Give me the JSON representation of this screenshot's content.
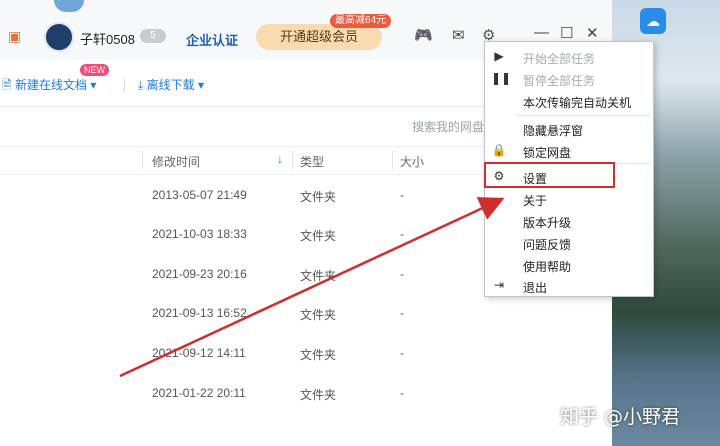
{
  "titlebar": {
    "username": "子轩0508",
    "level": "5",
    "cert_label": "企业认证",
    "vip_button": "开通超级会员",
    "vip_tag": "最高减64元"
  },
  "toolbar": {
    "new_doc": "新建在线文档",
    "new_tag": "NEW",
    "offline": "离线下载"
  },
  "search": {
    "placeholder": "搜索我的网盘"
  },
  "table": {
    "headers": {
      "modified": "修改时间",
      "type": "类型",
      "size": "大小"
    },
    "rows": [
      {
        "date": "2013-05-07 21:49",
        "type": "文件夹",
        "size": "-"
      },
      {
        "date": "2021-10-03 18:33",
        "type": "文件夹",
        "size": "-"
      },
      {
        "date": "2021-09-23 20:16",
        "type": "文件夹",
        "size": "-"
      },
      {
        "date": "2021-09-13 16:52",
        "type": "文件夹",
        "size": "-"
      },
      {
        "date": "2021-09-12 14:11",
        "type": "文件夹",
        "size": "-"
      },
      {
        "date": "2021-01-22 20:11",
        "type": "文件夹",
        "size": "-"
      }
    ]
  },
  "menu": {
    "items": [
      {
        "label": "开始全部任务",
        "icon": "play-icon",
        "disabled": true
      },
      {
        "label": "暂停全部任务",
        "icon": "pause-icon",
        "disabled": true
      },
      {
        "label": "本次传输完自动关机",
        "icon": "",
        "disabled": false
      },
      {
        "label": "隐藏悬浮窗",
        "icon": "",
        "disabled": false
      },
      {
        "label": "锁定网盘",
        "icon": "lock-icon",
        "disabled": false
      },
      {
        "label": "设置",
        "icon": "gear-icon",
        "disabled": false
      },
      {
        "label": "关于",
        "icon": "",
        "disabled": false
      },
      {
        "label": "版本升级",
        "icon": "",
        "disabled": false
      },
      {
        "label": "问题反馈",
        "icon": "",
        "disabled": false
      },
      {
        "label": "使用帮助",
        "icon": "",
        "disabled": false
      },
      {
        "label": "退出",
        "icon": "exit-icon",
        "disabled": false
      }
    ]
  },
  "annotation": {
    "color": "#d02d2d"
  },
  "watermark": "知乎 @小野君",
  "colors": {
    "accent": "#1e7be0",
    "vip": "#f8dcb0"
  }
}
